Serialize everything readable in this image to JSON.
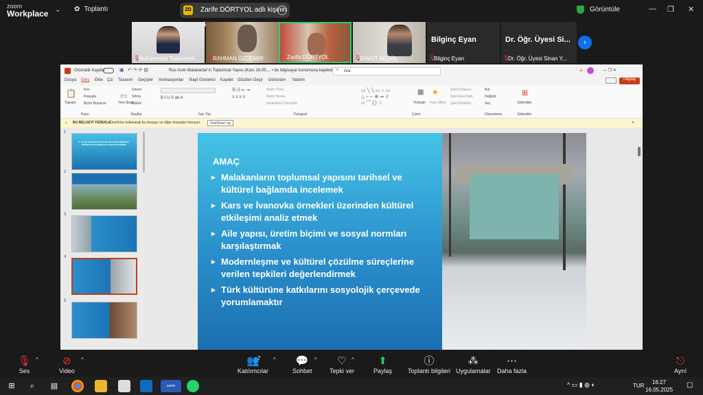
{
  "zoom": {
    "brand_top": "zoom",
    "brand_bottom": "Workplace",
    "meeting": "Toplantı",
    "share_text": "Zarife DÖRTYOL adlı kişinin ekran",
    "view": "Görüntüle",
    "share_avatar": "ZD"
  },
  "participants": [
    {
      "name": "Muhammed Taşkesenli...",
      "muted": true
    },
    {
      "name": "RAHMAN ÖZDEMİR",
      "muted": true
    },
    {
      "name": "Zarife DÖRTYOL",
      "muted": false,
      "active": true
    },
    {
      "name": "DAVUT AKGÜL",
      "muted": true
    },
    {
      "name": "Bilginç Eyan",
      "muted": true,
      "label": "Bilginç Eyan"
    },
    {
      "name": "Dr. Öğr. Üyesi Sinan Y...",
      "muted": true,
      "label": "Dr. Öğr. Üyesi Si..."
    }
  ],
  "ppt": {
    "autosave": "Otomatik Kaydet",
    "title": "Rus Asıllı Malakanlar'ın Toplumsal Yapısı (Kars 16.05....  •  bu bilgisayar konumuna kaydedildi",
    "search": "Ara",
    "share_btn": "Paylaş",
    "menu": [
      "Dosya",
      "Giriş",
      "Ekle",
      "Çiz",
      "Tasarım",
      "Geçişler",
      "Animasyonlar",
      "Slayt Gösterisi",
      "Kaydet",
      "Gözden Geçir",
      "Görünüm",
      "Yardım"
    ],
    "ribbon": {
      "paste": "Yapıştır",
      "cut": "Kes",
      "copy": "Kopyala",
      "fmt": "Biçim Boyacısı",
      "new_slide": "Yeni Slayt",
      "layout": "Düzen",
      "reset": "Sıfırla",
      "section": "Bölüm",
      "g1": "Pano",
      "g2": "Slaytlar",
      "g3": "Yazı Tipi",
      "g4": "Paragraf",
      "g5": "Çizim",
      "g6": "Düzenleme",
      "g7": "Eklentiler",
      "arrange": "Yerleştir",
      "styles": "Hızlı Stiller",
      "find": "Bul",
      "replace": "Değiştir",
      "select": "Seç",
      "addins": "Eklentiler",
      "text_dir": "Metin Yönü",
      "align": "Metni Hizala",
      "smartart": "SmartArt'a Dönüştür",
      "fill": "Şekil Dolgusu",
      "outline": "Şekil Ana Hattı",
      "effects": "Şekil Efektleri"
    },
    "info_bold": "BU BELGEYİ YEDEKLE",
    "info_text": "OneDrive kullanarak bu dosyayı ve diğer dosyaları koruyun.",
    "info_btn": "OneDrive'ı aç",
    "thumb_title": "II. ULUSLARARASI DR. RUSH VE KARSLARDİNASI DİZİSİYON KONGRESİ 12-14 MAYIS MANİSİN",
    "thumbs": [
      "1",
      "2",
      "3",
      "4",
      "5"
    ]
  },
  "slide": {
    "heading": "AMAÇ",
    "bullets": [
      "Malakanların toplumsal yapısını tarihsel ve kültürel bağlamda incelemek",
      "Kars ve İvanovka örnekleri üzerinden kültürel etkileşimi analiz etmek",
      "Aile yapısı, üretim biçimi ve sosyal normları karşılaştırmak",
      "Modernleşme ve kültürel çözülme süreçlerine verilen tepkileri değerlendirmek",
      "Türk kültürüne katkılarını sosyolojik çerçevede yorumlamaktır"
    ]
  },
  "toolbar": {
    "audio": "Ses",
    "video": "Video",
    "participants": "Katılımcılar",
    "participants_count": "7",
    "chat": "Sohbet",
    "react": "Tepki ver",
    "share": "Paylaş",
    "info": "Toplantı bilgileri",
    "apps": "Uygulamalar",
    "more": "Daha fazla",
    "leave": "Ayrıl"
  },
  "taskbar": {
    "lang": "TUR",
    "time": "16:27",
    "date": "16.05.2025"
  },
  "colors": {
    "zoom_blue": "#0e71eb",
    "share_green": "#2ecc71",
    "slide_blue": "#2a8fcc",
    "ppt_red": "#c43e1c"
  }
}
